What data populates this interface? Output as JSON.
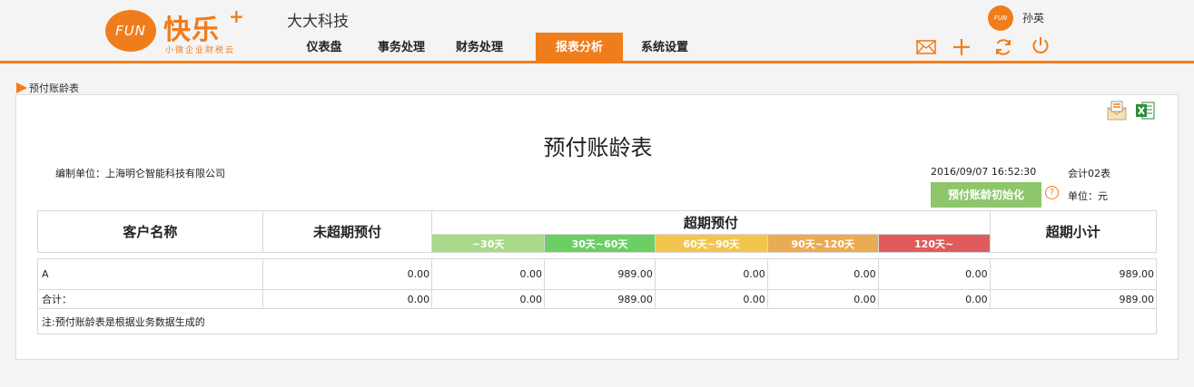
{
  "header": {
    "logo_text": "FUN",
    "brand_name": "快乐",
    "brand_plus": "+",
    "brand_slogan": "小微企业财税云",
    "company_name": "大大科技",
    "nav": [
      {
        "label": "仪表盘",
        "active": false
      },
      {
        "label": "事务处理",
        "active": false
      },
      {
        "label": "财务处理",
        "active": false
      },
      {
        "label": "报表分析",
        "active": true
      },
      {
        "label": "系统设置",
        "active": false
      }
    ],
    "user_avatar_text": "FUN",
    "user_name": "孙英",
    "icons": [
      "mail-icon",
      "plus-icon",
      "refresh-icon",
      "power-icon"
    ]
  },
  "breadcrumb": "预付账龄表",
  "report": {
    "title": "预付账龄表",
    "org_label": "编制单位：上海明仑智能科技有限公司",
    "datetime": "2016/09/07 16:52:30",
    "form_code": "会计02表",
    "init_button": "预付账龄初始化",
    "currency_unit": "单位：元",
    "headers": {
      "customer": "客户名称",
      "not_overdue": "未超期预付",
      "overdue": "超期预付",
      "overdue_subtotal": "超期小计",
      "buckets": [
        {
          "label": "~30天",
          "color": "#a8da8a"
        },
        {
          "label": "30天~60天",
          "color": "#6ccf64"
        },
        {
          "label": "60天~90天",
          "color": "#f2c64e"
        },
        {
          "label": "90天~120天",
          "color": "#e9ac54"
        },
        {
          "label": "120天~",
          "color": "#e05c5c"
        }
      ]
    },
    "rows": [
      {
        "customer": "A",
        "not_overdue": "0.00",
        "b1": "0.00",
        "b2": "989.00",
        "b3": "0.00",
        "b4": "0.00",
        "b5": "0.00",
        "subtotal": "989.00"
      }
    ],
    "total": {
      "label": "合计：",
      "not_overdue": "0.00",
      "b1": "0.00",
      "b2": "989.00",
      "b3": "0.00",
      "b4": "0.00",
      "b5": "0.00",
      "subtotal": "989.00"
    },
    "note": "注:预付账龄表是根据业务数据生成的"
  }
}
